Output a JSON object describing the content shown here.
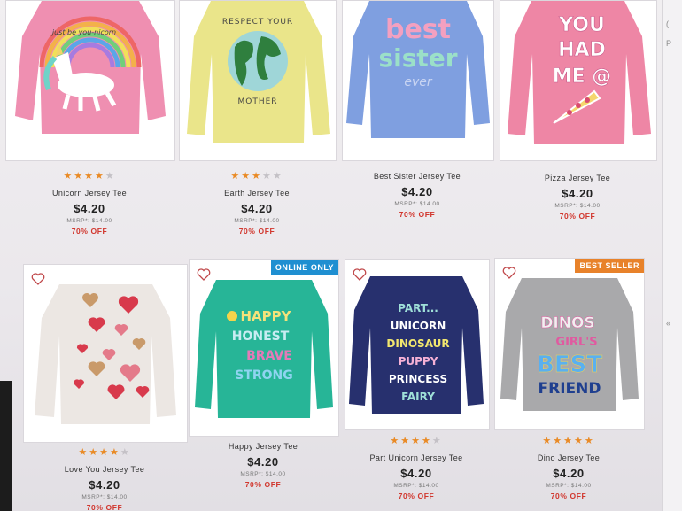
{
  "products": [
    {
      "name": "Unicorn Jersey Tee",
      "rating": 4,
      "price": "$4.20",
      "msrp": "MSRP*: $14.00",
      "discount": "70% OFF",
      "badge": "",
      "shirt_color": "#ef8fb1",
      "shirt_graphic": "rainbow-unicorn"
    },
    {
      "name": "Earth Jersey Tee",
      "rating": 3,
      "price": "$4.20",
      "msrp": "MSRP*: $14.00",
      "discount": "70% OFF",
      "badge": "",
      "shirt_color": "#eae58a",
      "shirt_graphic": "respect-your-mother-earth"
    },
    {
      "name": "Best Sister Jersey Tee",
      "rating": 0,
      "price": "$4.20",
      "msrp": "MSRP*: $14.00",
      "discount": "70% OFF",
      "badge": "",
      "shirt_color": "#7f9fe0",
      "shirt_graphic": "best-sister-ever"
    },
    {
      "name": "Pizza Jersey Tee",
      "rating": 0,
      "price": "$4.20",
      "msrp": "MSRP*: $14.00",
      "discount": "70% OFF",
      "badge": "",
      "shirt_color": "#ee86a5",
      "shirt_graphic": "you-had-me-at-pizza"
    },
    {
      "name": "Love You Jersey Tee",
      "rating": 4,
      "price": "$4.20",
      "msrp": "MSRP*: $14.00",
      "discount": "70% OFF",
      "badge": "",
      "shirt_color": "#ece7e3",
      "shirt_graphic": "hearts"
    },
    {
      "name": "Happy Jersey Tee",
      "rating": 0,
      "price": "$4.20",
      "msrp": "MSRP*: $14.00",
      "discount": "70% OFF",
      "badge": "ONLINE ONLY",
      "shirt_color": "#27b597",
      "shirt_graphic": "happy-honest-brave-strong"
    },
    {
      "name": "Part Unicorn Jersey Tee",
      "rating": 4,
      "price": "$4.20",
      "msrp": "MSRP*: $14.00",
      "discount": "70% OFF",
      "badge": "",
      "shirt_color": "#27306e",
      "shirt_graphic": "part-unicorn-dinosaur-puppy-princess-fairy"
    },
    {
      "name": "Dino Jersey Tee",
      "rating": 5,
      "price": "$4.20",
      "msrp": "MSRP*: $14.00",
      "discount": "70% OFF",
      "badge": "BEST SELLER",
      "shirt_color": "#a9a9ab",
      "shirt_graphic": "dinos-girls-best-friend"
    }
  ],
  "graphics": {
    "unicorn_text": "just be you-nicorn",
    "earth_top": "RESPECT YOUR",
    "earth_bottom": "MOTHER",
    "best": "best",
    "sister": "sister",
    "ever": "ever",
    "pizza_l1": "YOU",
    "pizza_l2": "HAD",
    "pizza_l3": "ME @",
    "happy_l1": "HAPPY",
    "happy_l2": "HONEST",
    "happy_l3": "BRAVE",
    "happy_l4": "STRONG",
    "part_l1": "PART...",
    "part_l2": "UNICORN",
    "part_l3": "DINOSAUR",
    "part_l4": "PUPPY",
    "part_l5": "PRINCESS",
    "part_l6": "FAIRY",
    "dino_l1": "DINOS",
    "dino_l2": "GIRL'S",
    "dino_l3": "BEST",
    "dino_l4": "FRIEND"
  },
  "icons": {
    "wishlist": "heart-outline-icon",
    "rating": "star-icon"
  },
  "colors": {
    "star_on": "#e98a25",
    "star_off": "#c4c1c6",
    "discount": "#d1372e",
    "online_badge": "#1f8fd1",
    "best_badge": "#e8822a"
  },
  "side_marks": [
    "(",
    "P",
    "«"
  ]
}
